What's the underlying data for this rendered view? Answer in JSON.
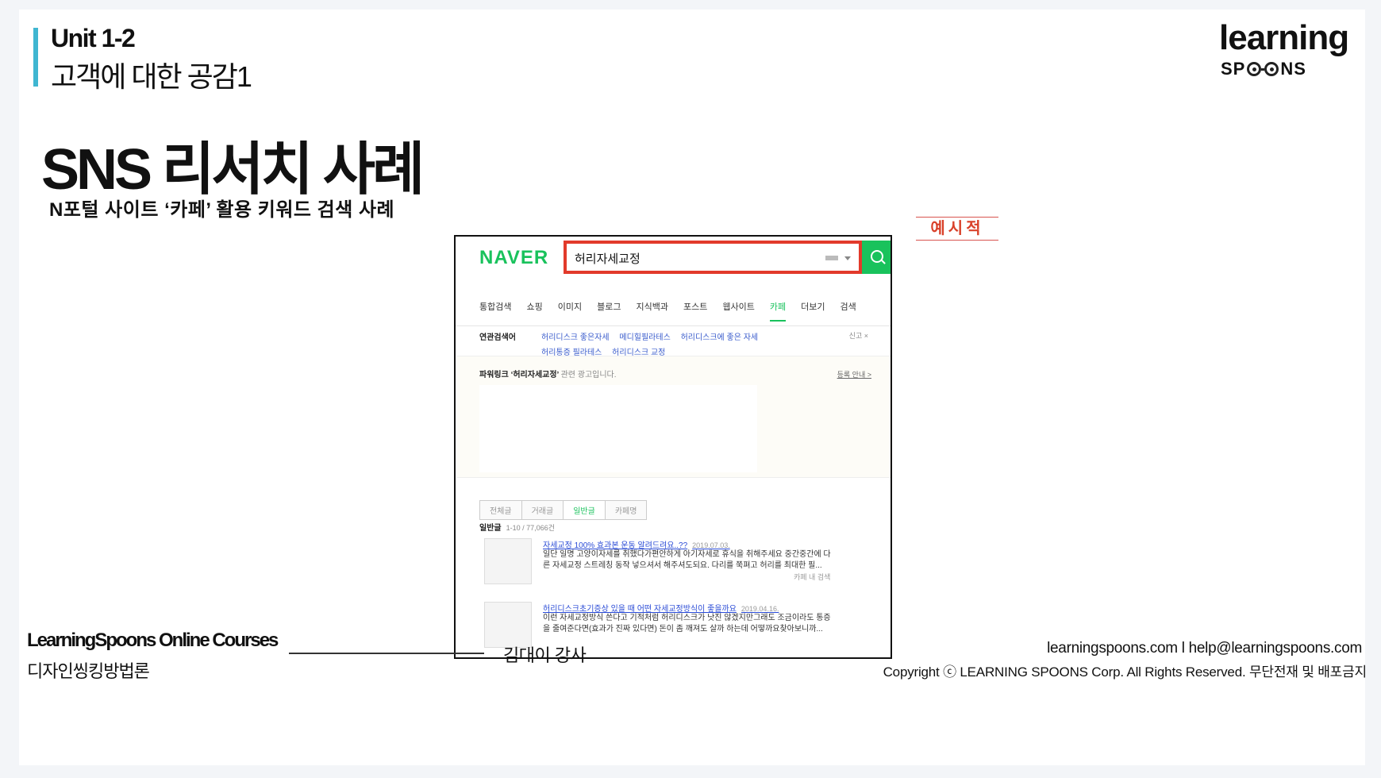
{
  "header": {
    "unit": "Unit 1-2",
    "unit_title": "고객에 대한 공감1",
    "logo_word": "learning",
    "logo_spoons_left": "SP",
    "logo_spoons_right": "NS"
  },
  "title": "SNS 리서치 사례",
  "subtitle": "N포털 사이트 ‘카페’ 활용 키워드 검색 사례",
  "example_tag": "예시적",
  "screenshot": {
    "brand": "NAVER",
    "query": "허리자세교정",
    "tabs": [
      "통합검색",
      "쇼핑",
      "이미지",
      "블로그",
      "지식백과",
      "포스트",
      "웹사이트",
      "카페",
      "더보기",
      "검색"
    ],
    "active_tab_index": 7,
    "related_label": "연관검색어",
    "related_keywords": [
      "허리디스크 좋은자세",
      "메디힐필라테스",
      "허리디스크에 좋은 자세",
      "허리통증 필라테스",
      "허리디스크 교정"
    ],
    "related_tools": "신고 ×",
    "powerlink_title": "파워링크 ‘허리자세교정’",
    "powerlink_note": "관련 광고입니다.",
    "powerlink_register": "등록 안내 >",
    "cafe_tabs": [
      "전체글",
      "거래글",
      "일반글",
      "카페명"
    ],
    "cafe_active_index": 2,
    "result_label": "일반글",
    "result_count": "1-10 / 77,066건",
    "results": [
      {
        "title": "자세교정 100% 효과본 운동 알려드려요..??",
        "date": "2019.07.03.",
        "desc": "일단 일명 고양이자세를 취했다가편안하게 아기자세로 휴식을 취해주세요 중간중간에 다른 자세교정 스트레칭 동작 넣으셔서 해주셔도되요. 다리를 쭉펴고 허리를 최대한 필...",
        "meta": "카페 내 검색"
      },
      {
        "title": "허리디스크초기증상 있을 때 어떤 자세교정방식이 좋을까요",
        "date": "2019.04.16.",
        "desc": "이런 자세교정방식 쓴다고 기적처럼 허리디스크가 낫진 않겠지만그래도 조금이라도 통증을 줄여준다면(효과가 진짜 있다면) 돈이 좀 깨져도 살까 하는데 어떻까요찾아보니까..."
      }
    ]
  },
  "footer": {
    "brand": "LearningSpoons Online Courses",
    "course": "디자인씽킹방법론",
    "teacher": "김대이 강사",
    "contact": "learningspoons.com l  help@learningspoons.com",
    "copyright": "Copyright ⓒ LEARNING SPOONS Corp. All Rights Reserved. 무단전재 및 배포금지"
  }
}
